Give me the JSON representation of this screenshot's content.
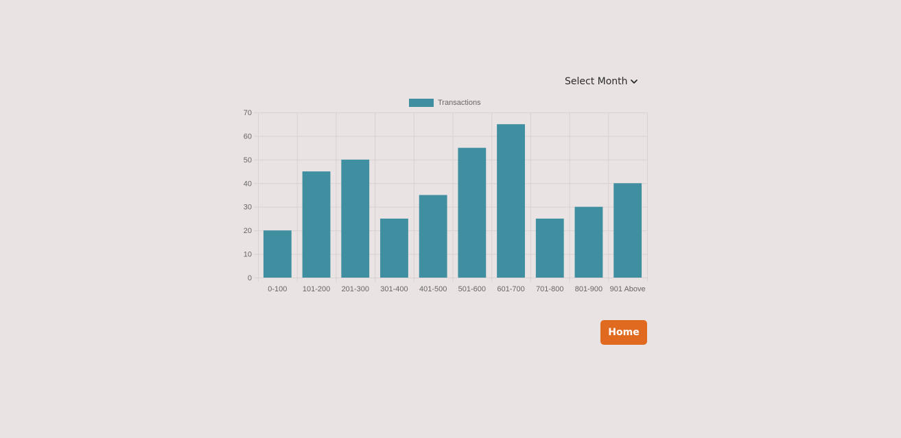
{
  "month_select": {
    "label": "Select Month",
    "icon": "chevron-down-icon"
  },
  "home_button": {
    "label": "Home"
  },
  "colors": {
    "bar": "#3f8fa0",
    "grid": "#d8d2d2",
    "axis_text": "#666666",
    "home": "#e06b20"
  },
  "chart_data": {
    "type": "bar",
    "categories": [
      "0-100",
      "101-200",
      "201-300",
      "301-400",
      "401-500",
      "501-600",
      "601-700",
      "701-800",
      "801-900",
      "901 Above"
    ],
    "series": [
      {
        "name": "Transactions",
        "values": [
          20,
          45,
          50,
          25,
          35,
          55,
          65,
          25,
          30,
          40
        ]
      }
    ],
    "ylim": [
      0,
      70
    ],
    "yticks": [
      0,
      10,
      20,
      30,
      40,
      50,
      60,
      70
    ],
    "grid": true,
    "legend": "top-center"
  }
}
